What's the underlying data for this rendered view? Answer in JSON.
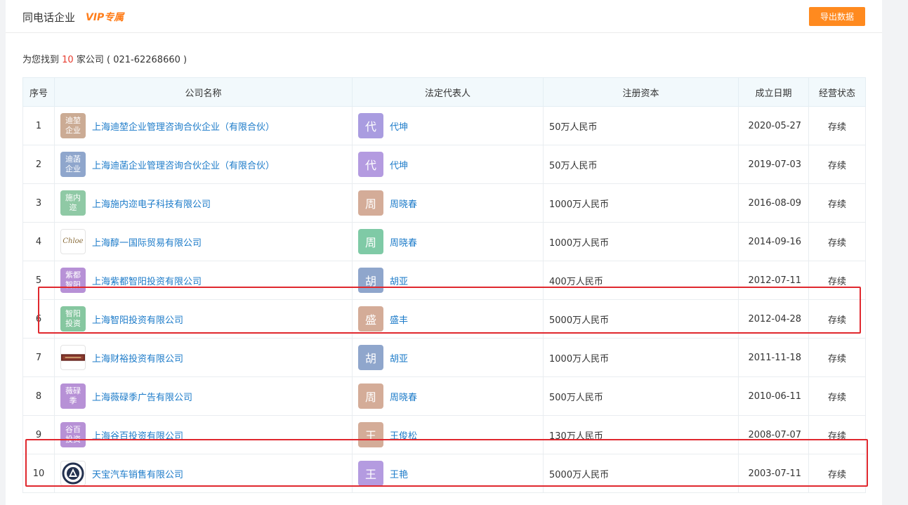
{
  "header": {
    "title": "同电话企业",
    "vip": "VIP专属",
    "export_label": "导出数据"
  },
  "summary": {
    "prefix": "为您找到",
    "count": "10",
    "suffix": "家公司",
    "phone": "( 021-62268660 )"
  },
  "table": {
    "columns": [
      "序号",
      "公司名称",
      "法定代表人",
      "注册资本",
      "成立日期",
      "经营状态"
    ],
    "rows": [
      {
        "num": "1",
        "logo_text": "迪堃企业",
        "logo_color": "#cbab94",
        "company": "上海迪堃企业管理咨询合伙企业（有限合伙）",
        "avatar": "代",
        "avatar_color": "#a99ce0",
        "legal": "代坤",
        "capital": "50万人民币",
        "date": "2020-05-27",
        "status": "存续"
      },
      {
        "num": "2",
        "logo_text": "迪菡企业",
        "logo_color": "#8fa6cc",
        "company": "上海迪菡企业管理咨询合伙企业（有限合伙）",
        "avatar": "代",
        "avatar_color": "#b49be0",
        "legal": "代坤",
        "capital": "50万人民币",
        "date": "2019-07-03",
        "status": "存续"
      },
      {
        "num": "3",
        "logo_text": "施内迩",
        "logo_color": "#8fc9a5",
        "company": "上海施内迩电子科技有限公司",
        "avatar": "周",
        "avatar_color": "#d4ac98",
        "legal": "周晓春",
        "capital": "1000万人民币",
        "date": "2016-08-09",
        "status": "存续"
      },
      {
        "num": "4",
        "logo_text": "Chloe",
        "logo_color": "",
        "logo_icon": "company-logo-icon",
        "company": "上海醇一国际贸易有限公司",
        "avatar": "周",
        "avatar_color": "#7fcaa6",
        "legal": "周晓春",
        "capital": "1000万人民币",
        "date": "2014-09-16",
        "status": "存续"
      },
      {
        "num": "5",
        "logo_text": "紫都智阳",
        "logo_color": "#b791d6",
        "company": "上海紫都智阳投资有限公司",
        "avatar": "胡",
        "avatar_color": "#8fa6cc",
        "legal": "胡亚",
        "capital": "400万人民币",
        "date": "2012-07-11",
        "status": "存续"
      },
      {
        "num": "6",
        "logo_text": "智阳投资",
        "logo_color": "#86c7a0",
        "company": "上海智阳投资有限公司",
        "avatar": "盛",
        "avatar_color": "#d4ac98",
        "legal": "盛丰",
        "capital": "5000万人民币",
        "date": "2012-04-28",
        "status": "存续"
      },
      {
        "num": "7",
        "logo_text": "",
        "logo_color": "",
        "logo_icon": "brand-banner-icon",
        "company": "上海财裕投资有限公司",
        "avatar": "胡",
        "avatar_color": "#8fa6cc",
        "legal": "胡亚",
        "capital": "1000万人民币",
        "date": "2011-11-18",
        "status": "存续"
      },
      {
        "num": "8",
        "logo_text": "薇碌季",
        "logo_color": "#b791d6",
        "company": "上海薇碌季广告有限公司",
        "avatar": "周",
        "avatar_color": "#d4ac98",
        "legal": "周晓春",
        "capital": "500万人民币",
        "date": "2010-06-11",
        "status": "存续"
      },
      {
        "num": "9",
        "logo_text": "谷百投资",
        "logo_color": "#b791d6",
        "company": "上海谷百投资有限公司",
        "avatar": "王",
        "avatar_color": "#d4ac98",
        "legal": "王俊松",
        "capital": "130万人民币",
        "date": "2008-07-07",
        "status": "存续"
      },
      {
        "num": "10",
        "logo_text": "",
        "logo_color": "",
        "logo_icon": "circle-emblem-icon",
        "company": "天宝汽车销售有限公司",
        "avatar": "王",
        "avatar_color": "#b49be0",
        "legal": "王艳",
        "capital": "5000万人民币",
        "date": "2003-07-11",
        "status": "存续"
      }
    ]
  },
  "colors": {
    "accent": "#ff8a1f",
    "link": "#1c7bc9",
    "status_green": "#3d9b2f",
    "highlight_red": "#e0282e"
  }
}
